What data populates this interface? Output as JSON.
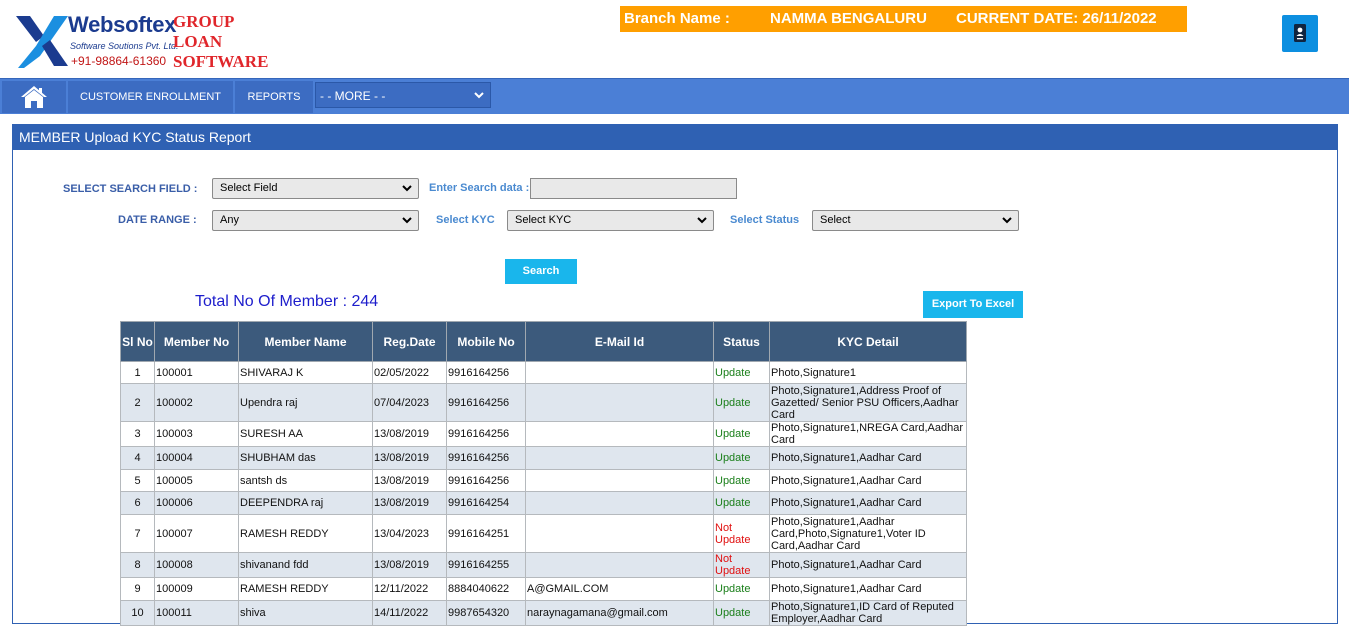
{
  "brand": {
    "name": "Websoftex",
    "tagline": "Software Soutions Pvt. Ltd.",
    "phone": "+91-98864-61360",
    "title_lines": [
      "GROUP",
      "LOAN",
      "SOFTWARE"
    ]
  },
  "branch_bar": {
    "branch_label": "Branch Name :",
    "branch_value": "NAMMA BENGALURU",
    "date_text": "CURRENT DATE: 26/11/2022"
  },
  "nav": {
    "home_icon": "home-icon",
    "customer_enrollment": "CUSTOMER ENROLLMENT",
    "reports": "REPORTS",
    "more_select": "- - MORE - -"
  },
  "page": {
    "title": "MEMBER Upload KYC Status Report"
  },
  "filters": {
    "search_field_label": "SELECT SEARCH FIELD :",
    "search_field_value": "Select Field",
    "search_data_label": "Enter Search data :",
    "search_data_value": "",
    "date_range_label": "DATE RANGE :",
    "date_range_value": "Any",
    "kyc_label": "Select KYC",
    "kyc_value": "Select KYC",
    "status_label": "Select Status",
    "status_value": "Select",
    "search_button": "Search",
    "export_button": "Export To Excel"
  },
  "summary": {
    "total_text": "Total No Of Member : 244"
  },
  "table": {
    "headers": [
      "Sl No",
      "Member No",
      "Member Name",
      "Reg.Date",
      "Mobile No",
      "E-Mail Id",
      "Status",
      "KYC Detail"
    ],
    "rows": [
      {
        "sl": "1",
        "member_no": "100001",
        "name": "SHIVARAJ K",
        "reg_date": "02/05/2022",
        "mobile": "9916164256",
        "email": "",
        "status": "Update",
        "kyc": "Photo,Signature1"
      },
      {
        "sl": "2",
        "member_no": "100002",
        "name": "Upendra raj",
        "reg_date": "07/04/2023",
        "mobile": "9916164256",
        "email": "",
        "status": "Update",
        "kyc": "Photo,Signature1,Address Proof of Gazetted/ Senior PSU Officers,Aadhar Card"
      },
      {
        "sl": "3",
        "member_no": "100003",
        "name": "SURESH AA",
        "reg_date": "13/08/2019",
        "mobile": "9916164256",
        "email": "",
        "status": "Update",
        "kyc": "Photo,Signature1,NREGA Card,Aadhar Card"
      },
      {
        "sl": "4",
        "member_no": "100004",
        "name": "SHUBHAM das",
        "reg_date": "13/08/2019",
        "mobile": "9916164256",
        "email": "",
        "status": "Update",
        "kyc": "Photo,Signature1,Aadhar Card"
      },
      {
        "sl": "5",
        "member_no": "100005",
        "name": "santsh ds",
        "reg_date": "13/08/2019",
        "mobile": "9916164256",
        "email": "",
        "status": "Update",
        "kyc": "Photo,Signature1,Aadhar Card"
      },
      {
        "sl": "6",
        "member_no": "100006",
        "name": "DEEPENDRA raj",
        "reg_date": "13/08/2019",
        "mobile": "9916164254",
        "email": "",
        "status": "Update",
        "kyc": "Photo,Signature1,Aadhar Card"
      },
      {
        "sl": "7",
        "member_no": "100007",
        "name": "RAMESH REDDY",
        "reg_date": "13/04/2023",
        "mobile": "9916164251",
        "email": "",
        "status": "Not Update",
        "kyc": "Photo,Signature1,Aadhar Card,Photo,Signature1,Voter ID Card,Aadhar Card"
      },
      {
        "sl": "8",
        "member_no": "100008",
        "name": "shivanand fdd",
        "reg_date": "13/08/2019",
        "mobile": "9916164255",
        "email": "",
        "status": "Not Update",
        "kyc": "Photo,Signature1,Aadhar Card"
      },
      {
        "sl": "9",
        "member_no": "100009",
        "name": "RAMESH REDDY",
        "reg_date": "12/11/2022",
        "mobile": "8884040622",
        "email": "A@GMAIL.COM",
        "status": "Update",
        "kyc": "Photo,Signature1,Aadhar Card"
      },
      {
        "sl": "10",
        "member_no": "100011",
        "name": "shiva",
        "reg_date": "14/11/2022",
        "mobile": "9987654320",
        "email": "naraynagamana@gmail.com",
        "status": "Update",
        "kyc": "Photo,Signature1,ID Card of Reputed Employer,Aadhar Card"
      }
    ]
  },
  "colors": {
    "nav_bg": "#4b7fd6",
    "panel_header": "#2f61b3",
    "table_header": "#3c5a7c",
    "orange_bar": "#ff9f00",
    "button_blue": "#19b6ec",
    "status_update": "#1a7f1a",
    "status_not_update": "#e01010"
  }
}
